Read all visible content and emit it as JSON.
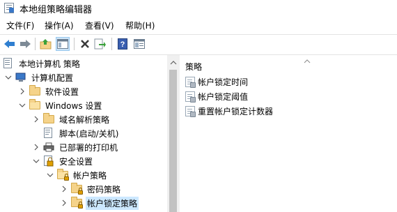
{
  "window": {
    "title": "本地组策略编辑器"
  },
  "menu": [
    "文件(F)",
    "操作(A)",
    "查看(V)",
    "帮助(H)"
  ],
  "toolbar": {
    "icons": [
      "back-arrow-icon",
      "forward-arrow-icon",
      "up-folder-icon",
      "show-hide-tree-icon",
      "delete-icon",
      "export-list-icon",
      "help-icon",
      "properties-icon"
    ]
  },
  "tree": {
    "root": "本地计算机 策略",
    "computer_config": "计算机配置",
    "software_settings": "软件设置",
    "windows_settings": "Windows 设置",
    "name_resolution_policy": "域名解析策略",
    "scripts": "脚本(启动/关机)",
    "deployed_printers": "已部署的打印机",
    "security_settings": "安全设置",
    "account_policies": "帐户策略",
    "password_policy": "密码策略",
    "account_lockout_policy": "帐户锁定策略"
  },
  "list": {
    "column_header": "策略",
    "items": [
      "帐户锁定时间",
      "帐户锁定阈值",
      "重置帐户锁定计数器"
    ]
  },
  "colors": {
    "selection": "#cce8ff",
    "folder": "#f5d38a",
    "accent": "#3a78c8"
  }
}
